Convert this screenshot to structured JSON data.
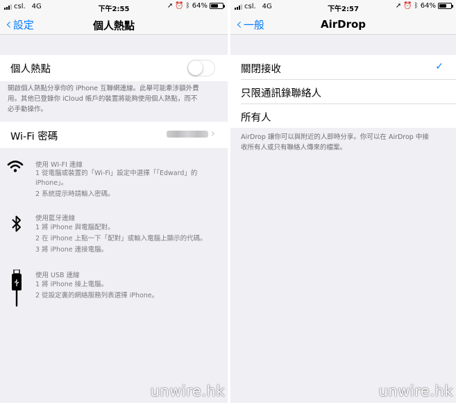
{
  "left": {
    "status": {
      "carrier": "csl.",
      "network": "4G",
      "time": "下午2:55",
      "battery": "64%"
    },
    "nav": {
      "back": "設定",
      "title": "個人熱點"
    },
    "hotspot": {
      "label": "個人熱點",
      "enabled": false
    },
    "hotspot_note": [
      "開啟個人熱點分享你的 iPhone 互聯網連線。此舉可能牽涉額外費",
      "用。其他已登錄你 iCloud 帳戶的裝置將能夠使用個人熱點，而不",
      "必手動操作。"
    ],
    "wifi_password": {
      "label": "Wi-Fi 密碼"
    },
    "methods": [
      {
        "icon": "wifi-icon",
        "title": "使用 WI-FI 連線",
        "lines": [
          "1 從電腦或裝置的「Wi-Fi」設定中選擇「「Edward」的",
          "iPhone」。",
          "2 系統提示時請輸入密碼。"
        ]
      },
      {
        "icon": "bluetooth-icon",
        "title": "使用藍牙連線",
        "lines": [
          "1 將 iPhone 與電腦配對。",
          "2 在 iPhone 上點一下「配對」或輸入電腦上顯示的代碼。",
          "3 將 iPhone 連接電腦。"
        ]
      },
      {
        "icon": "usb-icon",
        "title": "使用 USB 連線",
        "lines": [
          "1 將 iPhone 接上電腦。",
          "2 從設定裏的網絡服務列表選擇 iPhone。"
        ]
      }
    ],
    "watermark": "unwire.hk"
  },
  "right": {
    "status": {
      "carrier": "csl.",
      "network": "4G",
      "time": "下午2:57",
      "battery": "64%"
    },
    "nav": {
      "back": "一般",
      "title": "AirDrop"
    },
    "options": [
      {
        "label": "關閉接收",
        "selected": true
      },
      {
        "label": "只限通訊錄聯絡人",
        "selected": false
      },
      {
        "label": "所有人",
        "selected": false
      }
    ],
    "note": [
      "AirDrop 讓你可以與附近的人即時分享。你可以在 AirDrop 中接",
      "收所有人或只有聯絡人傳來的檔案。"
    ],
    "watermark": "unwire.hk"
  },
  "colors": {
    "accent": "#007aff",
    "background": "#efeff4",
    "secondary_text": "#6d6d72"
  }
}
